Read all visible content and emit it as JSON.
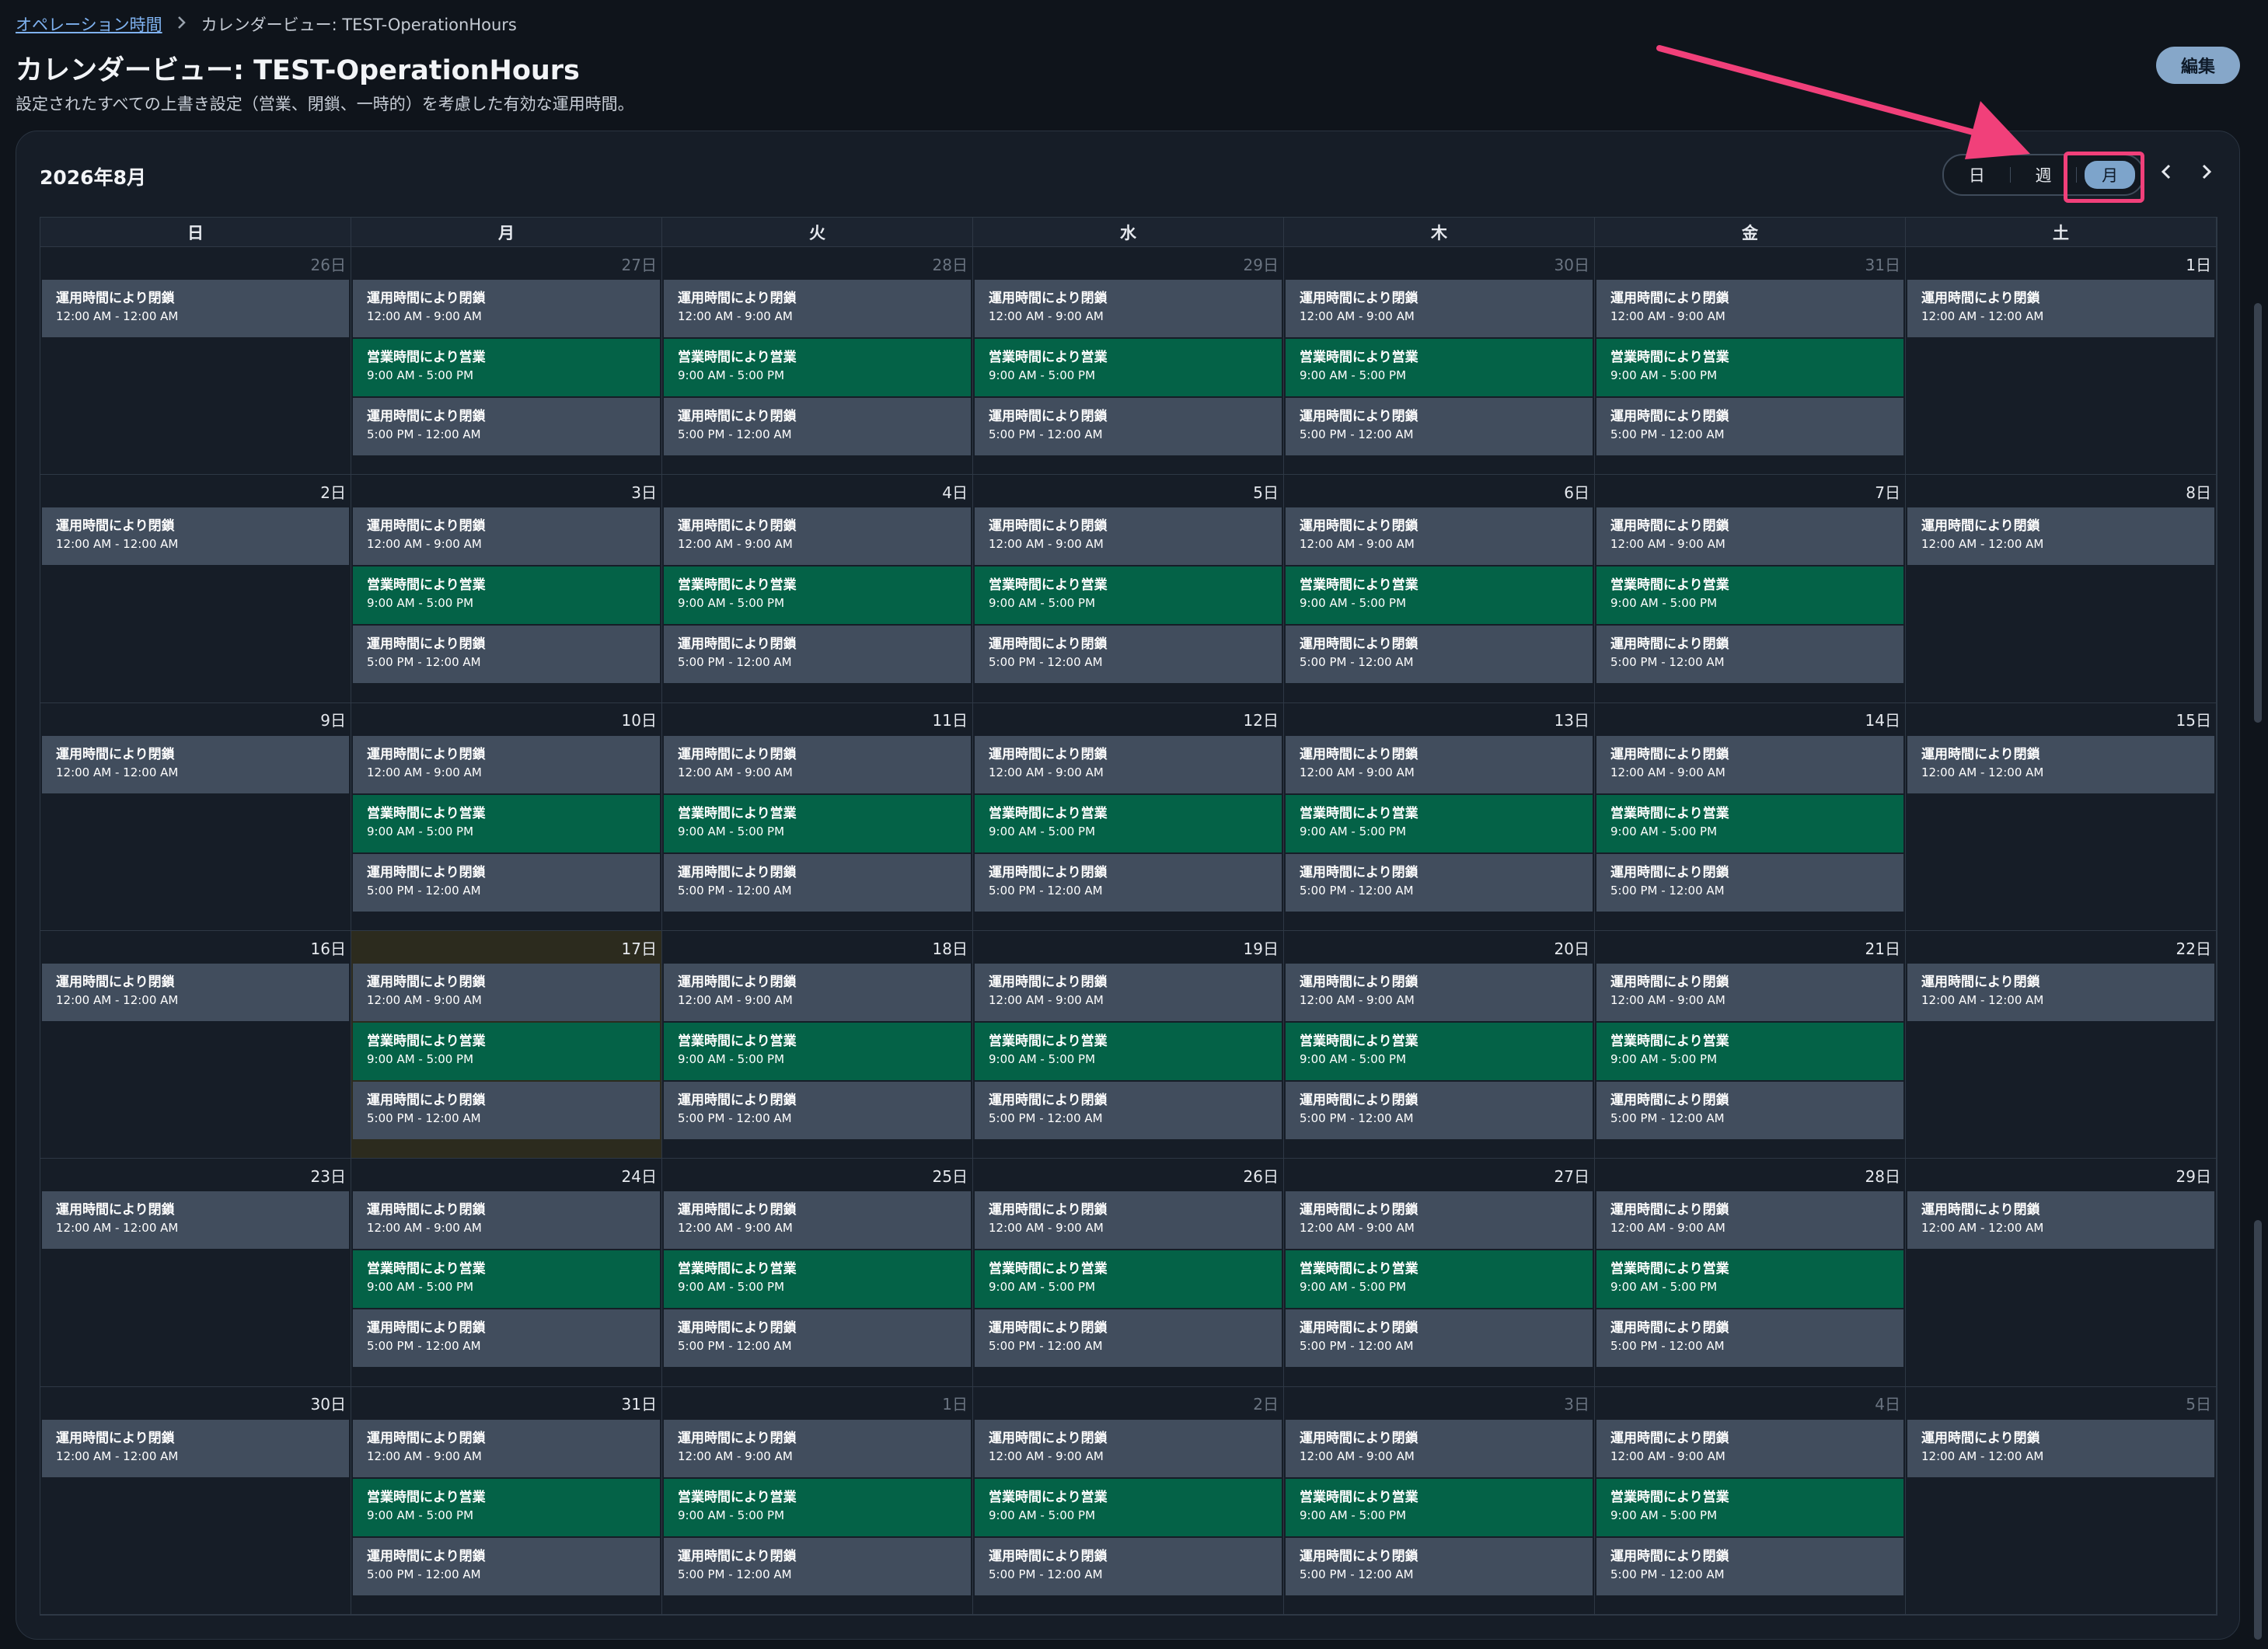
{
  "breadcrumb": {
    "parent": "オペレーション時間",
    "current": "カレンダービュー: TEST-OperationHours"
  },
  "header": {
    "title": "カレンダービュー: TEST-OperationHours",
    "subtitle": "設定されたすべての上書き設定（営業、閉鎖、一時的）を考慮した有効な運用時間。",
    "edit_label": "編集"
  },
  "calendar": {
    "month_label": "2026年8月",
    "views": [
      "日",
      "週",
      "月"
    ],
    "active_view": "月",
    "weekdays": [
      "日",
      "月",
      "火",
      "水",
      "木",
      "金",
      "土"
    ],
    "events": {
      "closed_full": {
        "title": "運用時間により閉鎖",
        "time": "12:00 AM - 12:00 AM"
      },
      "closed_morning": {
        "title": "運用時間により閉鎖",
        "time": "12:00 AM - 9:00 AM"
      },
      "open_day": {
        "title": "営業時間により営業",
        "time": "9:00 AM - 5:00 PM"
      },
      "closed_evening": {
        "title": "運用時間により閉鎖",
        "time": "5:00 PM - 12:00 AM"
      }
    },
    "weeks": [
      [
        "26日",
        "27日",
        "28日",
        "29日",
        "30日",
        "31日",
        "1日"
      ],
      [
        "2日",
        "3日",
        "4日",
        "5日",
        "6日",
        "7日",
        "8日"
      ],
      [
        "9日",
        "10日",
        "11日",
        "12日",
        "13日",
        "14日",
        "15日"
      ],
      [
        "16日",
        "17日",
        "18日",
        "19日",
        "20日",
        "21日",
        "22日"
      ],
      [
        "23日",
        "24日",
        "25日",
        "26日",
        "27日",
        "28日",
        "29日"
      ],
      [
        "30日",
        "31日",
        "1日",
        "2日",
        "3日",
        "4日",
        "5日"
      ]
    ],
    "other_month_cells": [
      [
        0,
        0
      ],
      [
        0,
        1
      ],
      [
        0,
        2
      ],
      [
        0,
        3
      ],
      [
        0,
        4
      ],
      [
        0,
        5
      ],
      [
        5,
        2
      ],
      [
        5,
        3
      ],
      [
        5,
        4
      ],
      [
        5,
        5
      ],
      [
        5,
        6
      ]
    ],
    "today_cell": [
      3,
      1
    ]
  },
  "colors": {
    "closed": "#414d5d",
    "open": "#046247",
    "accent_highlight": "#f1407a",
    "active_view": "#7da4cb"
  }
}
